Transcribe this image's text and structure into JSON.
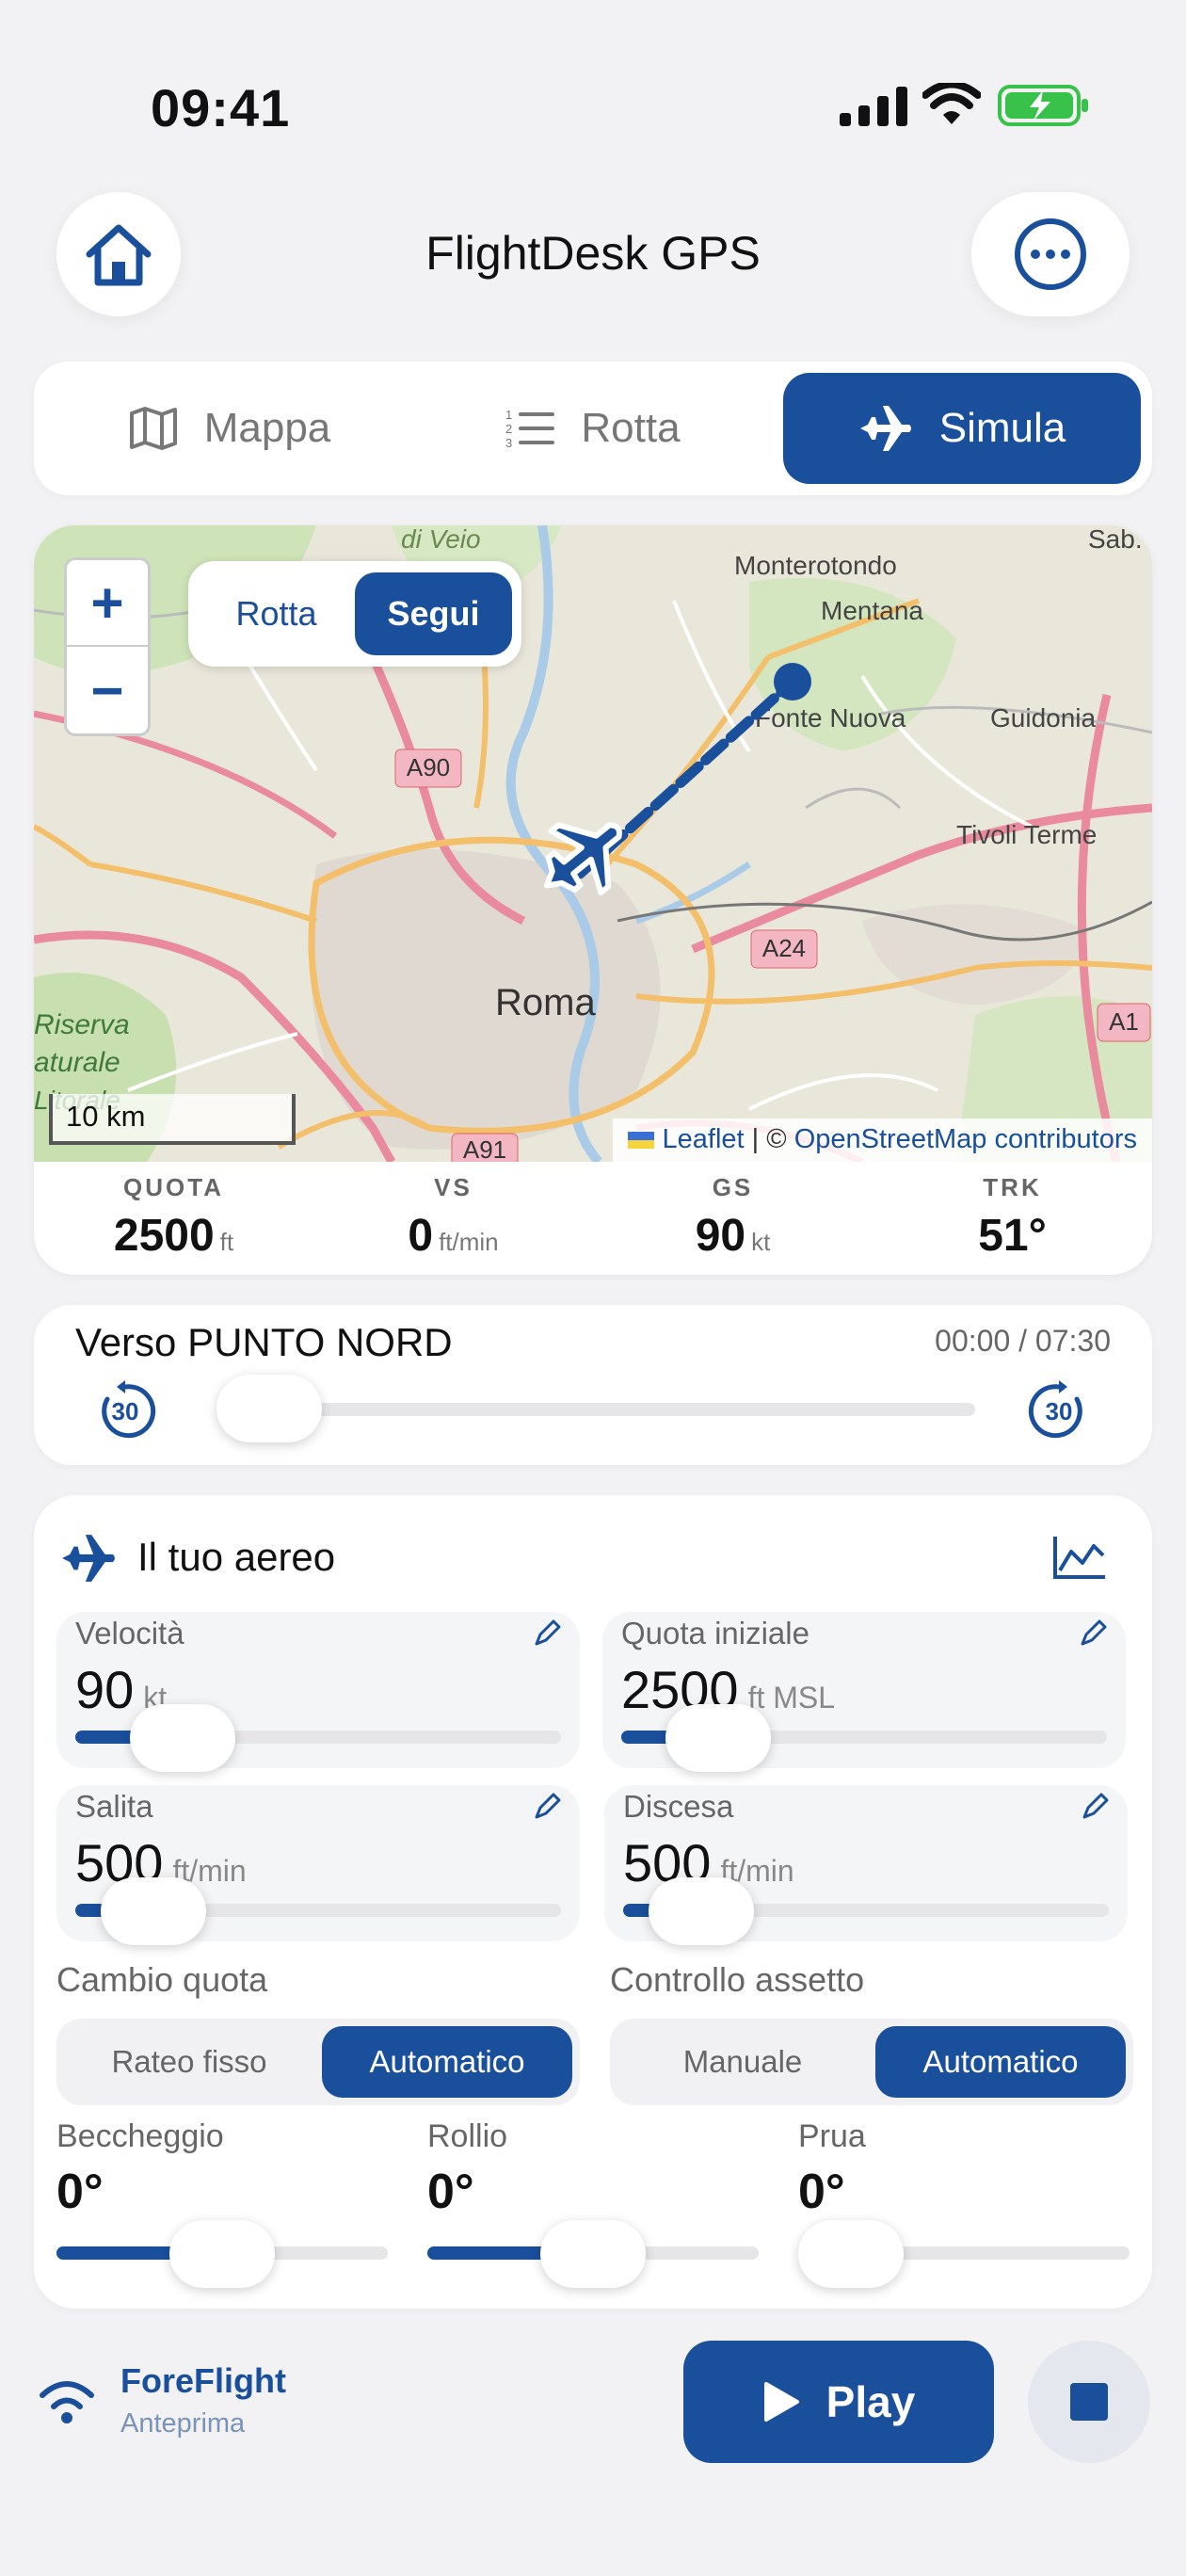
{
  "status_bar": {
    "time": "09:41"
  },
  "header": {
    "title": "FlightDesk GPS"
  },
  "tabs": [
    {
      "label": "Mappa",
      "active": false
    },
    {
      "label": "Rotta",
      "active": false
    },
    {
      "label": "Simula",
      "active": true
    }
  ],
  "map": {
    "segment": [
      {
        "label": "Rotta",
        "active": false
      },
      {
        "label": "Segui",
        "active": true
      }
    ],
    "zoom_in": "+",
    "zoom_out": "−",
    "scale": "10 km",
    "attribution": {
      "leaflet": "Leaflet",
      "separator": " | © ",
      "osm": "OpenStreetMap contributors"
    },
    "places": [
      "di Veio",
      "Monterotondo",
      "Mentana",
      "Fonte Nuova",
      "Guidonia",
      "Tivoli Terme",
      "Roma",
      "Riserva",
      "aturale",
      "Litorale",
      "Sab."
    ],
    "roads": [
      "A90",
      "A24",
      "A1",
      "A91"
    ]
  },
  "stats": [
    {
      "label": "QUOTA",
      "value": "2500",
      "unit": "ft"
    },
    {
      "label": "VS",
      "value": "0",
      "unit": "ft/min"
    },
    {
      "label": "GS",
      "value": "90",
      "unit": "kt"
    },
    {
      "label": "TRK",
      "value": "51°",
      "unit": ""
    }
  ],
  "progress": {
    "title": "Verso PUNTO NORD",
    "time": "00:00 / 07:30",
    "back_label": "30",
    "fwd_label": "30",
    "fraction": 0
  },
  "aircraft": {
    "title": "Il tuo aereo",
    "params": [
      {
        "label": "Velocità",
        "value": "90",
        "unit": "kt",
        "fraction": 0.22
      },
      {
        "label": "Quota iniziale",
        "value": "2500",
        "unit": "ft MSL",
        "fraction": 0.2
      },
      {
        "label": "Salita",
        "value": "500",
        "unit": "ft/min",
        "fraction": 0.16
      },
      {
        "label": "Discesa",
        "value": "500",
        "unit": "ft/min",
        "fraction": 0.16
      }
    ],
    "altitude_change": {
      "label": "Cambio quota",
      "options": [
        "Rateo fisso",
        "Automatico"
      ],
      "selected": 1
    },
    "attitude_control": {
      "label": "Controllo assetto",
      "options": [
        "Manuale",
        "Automatico"
      ],
      "selected": 1
    },
    "attitude": [
      {
        "label": "Beccheggio",
        "value": "0°",
        "fraction": 0.5
      },
      {
        "label": "Rollio",
        "value": "0°",
        "fraction": 0.5
      },
      {
        "label": "Prua",
        "value": "0°",
        "fraction": 0
      }
    ]
  },
  "bottom": {
    "output_name": "ForeFlight",
    "output_sub": "Anteprima",
    "play_label": "Play"
  },
  "colors": {
    "accent": "#1a4f9c",
    "battery": "#39c24a"
  }
}
